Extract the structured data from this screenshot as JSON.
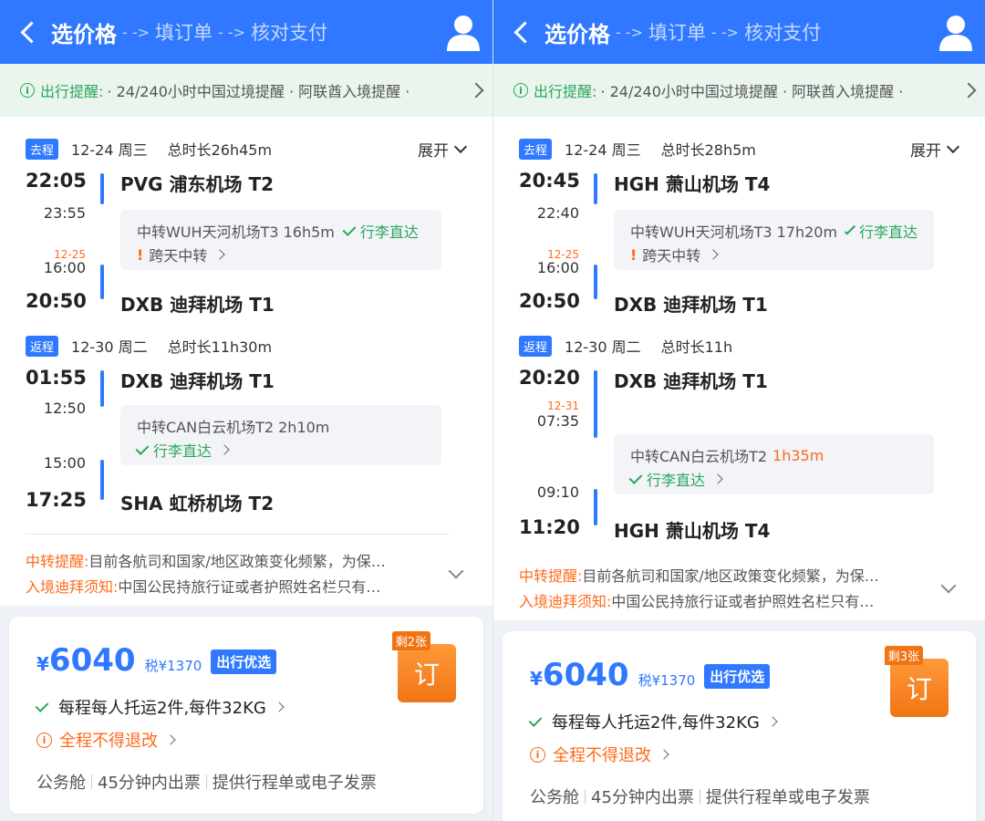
{
  "panels": [
    {
      "header": {
        "step_current": "选价格",
        "step_2": "填订单",
        "step_3": "核对支付",
        "arrow": "- ->"
      },
      "reminder": {
        "label": "出行提醒:",
        "text": "· 24/240小时中国过境提醒 · 阿联酋入境提醒 ·"
      },
      "outbound": {
        "tag": "去程",
        "date": "12-24 周三",
        "duration": "总时长26h45m",
        "expand_label": "展开",
        "dep_time": "22:05",
        "dep_airport": "PVG 浦东机场 T2",
        "leg1_arr_time": "23:55",
        "leg2_date": "12-25",
        "leg2_dep_time": "16:00",
        "arr_time": "20:50",
        "arr_airport": "DXB 迪拜机场 T1",
        "transfer_text": "中转WUH天河机场T3 16h5m",
        "transfer_highlight": "",
        "baggage_label": "行李直达",
        "cross_day_label": "跨天中转"
      },
      "inbound": {
        "tag": "返程",
        "date": "12-30 周二",
        "duration": "总时长11h30m",
        "dep_time": "01:55",
        "dep_airport": "DXB 迪拜机场 T1",
        "leg1_arr_date": "",
        "leg1_arr_time": "12:50",
        "leg2_dep_time": "15:00",
        "arr_time": "17:25",
        "arr_airport": "SHA 虹桥机场 T2",
        "transfer_text": "中转CAN白云机场T2 2h10m",
        "transfer_highlight": "",
        "baggage_label": "行李直达"
      },
      "notices": {
        "transfer_label": "中转提醒:",
        "transfer_text": "目前各航司和国家/地区政策变化频繁，为保…",
        "entry_label": "入境迪拜须知:",
        "entry_text": "中国公民持旅行证或者护照姓名栏只有…"
      },
      "price": {
        "currency": "¥",
        "amount": "6040",
        "tax": "税¥1370",
        "badge": "出行优选",
        "remaining": "剩2张",
        "book_label": "订",
        "baggage": "每程每人托运2件,每件32KG",
        "refund": "全程不得退改",
        "features": [
          "公务舱",
          "45分钟内出票",
          "提供行程单或电子发票"
        ]
      }
    },
    {
      "header": {
        "step_current": "选价格",
        "step_2": "填订单",
        "step_3": "核对支付",
        "arrow": "- ->"
      },
      "reminder": {
        "label": "出行提醒:",
        "text": "· 24/240小时中国过境提醒 · 阿联酋入境提醒 ·"
      },
      "outbound": {
        "tag": "去程",
        "date": "12-24 周三",
        "duration": "总时长28h5m",
        "expand_label": "展开",
        "dep_time": "20:45",
        "dep_airport": "HGH 萧山机场 T4",
        "leg1_arr_time": "22:40",
        "leg2_date": "12-25",
        "leg2_dep_time": "16:00",
        "arr_time": "20:50",
        "arr_airport": "DXB 迪拜机场 T1",
        "transfer_text": "中转WUH天河机场T3 17h20m",
        "transfer_highlight": "",
        "baggage_label": "行李直达",
        "cross_day_label": "跨天中转"
      },
      "inbound": {
        "tag": "返程",
        "date": "12-30 周二",
        "duration": "总时长11h",
        "dep_time": "20:20",
        "dep_airport": "DXB 迪拜机场 T1",
        "leg1_arr_date": "12-31",
        "leg1_arr_time": "07:35",
        "leg2_dep_time": "09:10",
        "arr_time": "11:20",
        "arr_airport": "HGH 萧山机场 T4",
        "transfer_text": "中转CAN白云机场T2",
        "transfer_highlight": "1h35m",
        "baggage_label": "行李直达"
      },
      "notices": {
        "transfer_label": "中转提醒:",
        "transfer_text": "目前各航司和国家/地区政策变化频繁，为保…",
        "entry_label": "入境迪拜须知:",
        "entry_text": "中国公民持旅行证或者护照姓名栏只有…"
      },
      "price": {
        "currency": "¥",
        "amount": "6040",
        "tax": "税¥1370",
        "badge": "出行优选",
        "remaining": "剩3张",
        "book_label": "订",
        "baggage": "每程每人托运2件,每件32KG",
        "refund": "全程不得退改",
        "features": [
          "公务舱",
          "45分钟内出票",
          "提供行程单或电子发票"
        ]
      }
    }
  ]
}
